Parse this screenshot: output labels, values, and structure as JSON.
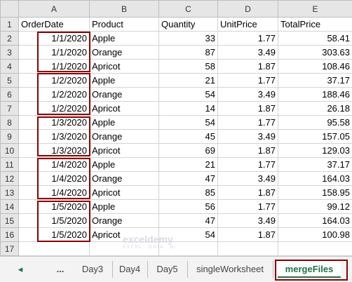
{
  "columns": [
    "A",
    "B",
    "C",
    "D",
    "E"
  ],
  "header_row": {
    "row": "1",
    "A": "OrderDate",
    "B": "Product",
    "C": "Quantity",
    "D": "UnitPrice",
    "E": "TotalPrice"
  },
  "rows": [
    {
      "row": "2",
      "A": "1/1/2020",
      "B": "Apple",
      "C": "33",
      "D": "1.77",
      "E": "58.41"
    },
    {
      "row": "3",
      "A": "1/1/2020",
      "B": "Orange",
      "C": "87",
      "D": "3.49",
      "E": "303.63"
    },
    {
      "row": "4",
      "A": "1/1/2020",
      "B": "Apricot",
      "C": "58",
      "D": "1.87",
      "E": "108.46"
    },
    {
      "row": "5",
      "A": "1/2/2020",
      "B": "Apple",
      "C": "21",
      "D": "1.77",
      "E": "37.17"
    },
    {
      "row": "6",
      "A": "1/2/2020",
      "B": "Orange",
      "C": "54",
      "D": "3.49",
      "E": "188.46"
    },
    {
      "row": "7",
      "A": "1/2/2020",
      "B": "Apricot",
      "C": "14",
      "D": "1.87",
      "E": "26.18"
    },
    {
      "row": "8",
      "A": "1/3/2020",
      "B": "Apple",
      "C": "54",
      "D": "1.77",
      "E": "95.58"
    },
    {
      "row": "9",
      "A": "1/3/2020",
      "B": "Orange",
      "C": "45",
      "D": "3.49",
      "E": "157.05"
    },
    {
      "row": "10",
      "A": "1/3/2020",
      "B": "Apricot",
      "C": "69",
      "D": "1.87",
      "E": "129.03"
    },
    {
      "row": "11",
      "A": "1/4/2020",
      "B": "Apple",
      "C": "21",
      "D": "1.77",
      "E": "37.17"
    },
    {
      "row": "12",
      "A": "1/4/2020",
      "B": "Orange",
      "C": "47",
      "D": "3.49",
      "E": "164.03"
    },
    {
      "row": "13",
      "A": "1/4/2020",
      "B": "Apricot",
      "C": "85",
      "D": "1.87",
      "E": "158.95"
    },
    {
      "row": "14",
      "A": "1/5/2020",
      "B": "Apple",
      "C": "56",
      "D": "1.77",
      "E": "99.12"
    },
    {
      "row": "15",
      "A": "1/5/2020",
      "B": "Orange",
      "C": "47",
      "D": "3.49",
      "E": "164.03"
    },
    {
      "row": "16",
      "A": "1/5/2020",
      "B": "Apricot",
      "C": "54",
      "D": "1.87",
      "E": "100.98"
    },
    {
      "row": "17",
      "A": "",
      "B": "",
      "C": "",
      "D": "",
      "E": ""
    }
  ],
  "watermark": {
    "name": "exceldemy",
    "tagline": "EXCEL · DATA · BI"
  },
  "tabs": {
    "prev": "◂",
    "more": "...",
    "sheets": [
      "Day3",
      "Day4",
      "Day5",
      "singleWorksheet"
    ],
    "active": "mergeFiles"
  },
  "colors": {
    "highlight": "#8b0000",
    "active_tab_text": "#1e7145"
  }
}
